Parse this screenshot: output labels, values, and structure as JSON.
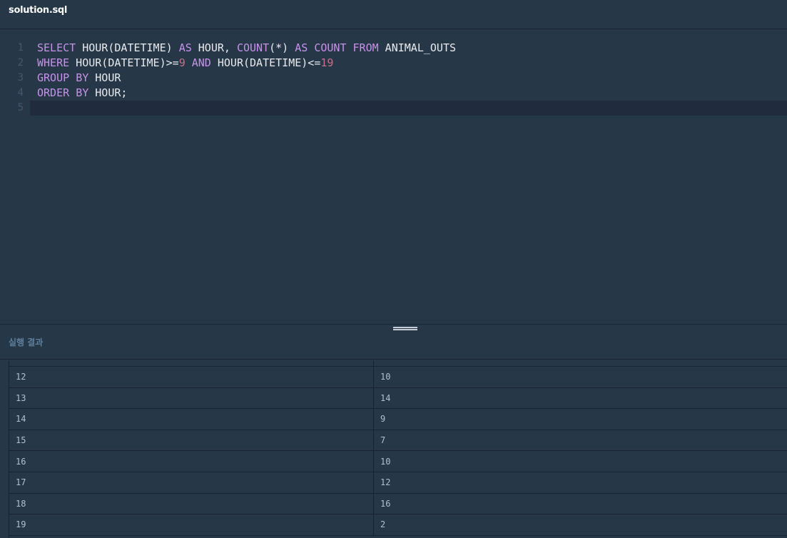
{
  "tab": {
    "title": "solution.sql"
  },
  "editor": {
    "lines": [
      {
        "num": "1",
        "tokens": [
          {
            "t": "SELECT",
            "k": "kw"
          },
          {
            "t": " HOUR(DATETIME) ",
            "k": ""
          },
          {
            "t": "AS",
            "k": "kw"
          },
          {
            "t": " HOUR, ",
            "k": ""
          },
          {
            "t": "COUNT",
            "k": "kw"
          },
          {
            "t": "(*) ",
            "k": ""
          },
          {
            "t": "AS",
            "k": "kw"
          },
          {
            "t": " ",
            "k": ""
          },
          {
            "t": "COUNT",
            "k": "kw"
          },
          {
            "t": " ",
            "k": ""
          },
          {
            "t": "FROM",
            "k": "kw"
          },
          {
            "t": " ANIMAL_OUTS",
            "k": ""
          }
        ]
      },
      {
        "num": "2",
        "tokens": [
          {
            "t": "WHERE",
            "k": "kw"
          },
          {
            "t": " HOUR(DATETIME)>=",
            "k": ""
          },
          {
            "t": "9",
            "k": "num"
          },
          {
            "t": " ",
            "k": ""
          },
          {
            "t": "AND",
            "k": "kw"
          },
          {
            "t": " HOUR(DATETIME)<=",
            "k": ""
          },
          {
            "t": "19",
            "k": "num"
          }
        ]
      },
      {
        "num": "3",
        "tokens": [
          {
            "t": "GROUP",
            "k": "kw"
          },
          {
            "t": " ",
            "k": ""
          },
          {
            "t": "BY",
            "k": "kw"
          },
          {
            "t": " HOUR",
            "k": ""
          }
        ]
      },
      {
        "num": "4",
        "tokens": [
          {
            "t": "ORDER",
            "k": "kw"
          },
          {
            "t": " ",
            "k": ""
          },
          {
            "t": "BY",
            "k": "kw"
          },
          {
            "t": " HOUR;",
            "k": ""
          }
        ]
      },
      {
        "num": "5",
        "tokens": []
      }
    ]
  },
  "results": {
    "label": "실행 결과",
    "rows": [
      [
        "12",
        "10"
      ],
      [
        "13",
        "14"
      ],
      [
        "14",
        "9"
      ],
      [
        "15",
        "7"
      ],
      [
        "16",
        "10"
      ],
      [
        "17",
        "12"
      ],
      [
        "18",
        "16"
      ],
      [
        "19",
        "2"
      ]
    ]
  }
}
